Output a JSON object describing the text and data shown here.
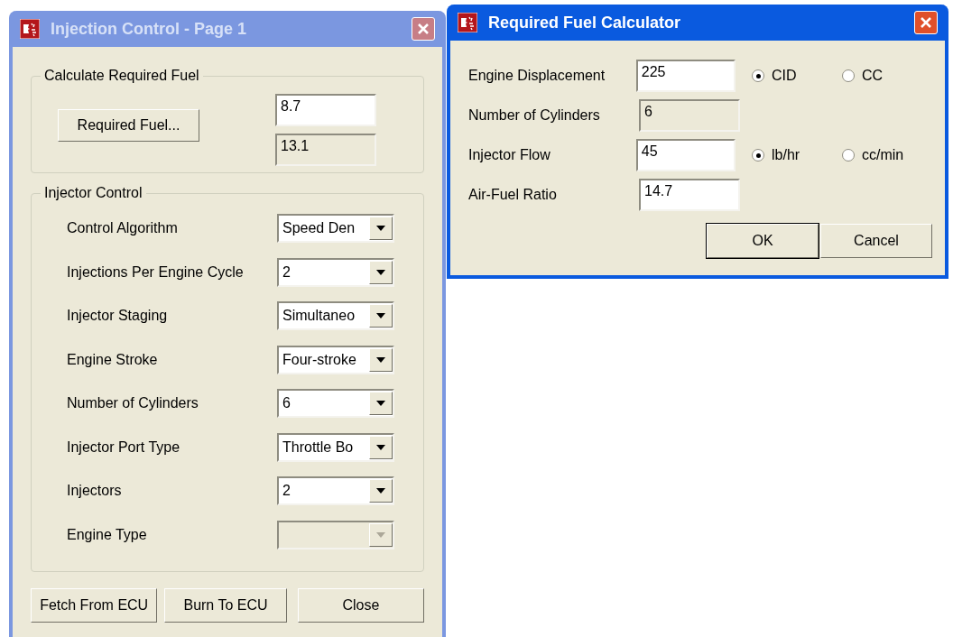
{
  "injection_window": {
    "title": "Injection Control - Page 1",
    "active": false,
    "fuel_group": {
      "legend": "Calculate Required Fuel",
      "button": "Required Fuel...",
      "fields": [
        {
          "value": "8.7",
          "readonly": false
        },
        {
          "value": "13.1",
          "readonly": true
        }
      ]
    },
    "injector_group": {
      "legend": "Injector Control",
      "rows": [
        {
          "label": "Control Algorithm",
          "value": "Speed Den",
          "disabled": false
        },
        {
          "label": "Injections Per Engine Cycle",
          "value": "2",
          "disabled": false
        },
        {
          "label": "Injector Staging",
          "value": "Simultaneo",
          "disabled": false
        },
        {
          "label": "Engine Stroke",
          "value": "Four-stroke",
          "disabled": false
        },
        {
          "label": "Number of Cylinders",
          "value": "6",
          "disabled": false
        },
        {
          "label": "Injector Port Type",
          "value": "Throttle Bo",
          "disabled": false
        },
        {
          "label": "Injectors",
          "value": "2",
          "disabled": false
        },
        {
          "label": "Engine Type",
          "disabled": true
        }
      ]
    },
    "buttons": [
      "Fetch From ECU",
      "Burn To ECU",
      "Close"
    ]
  },
  "calculator_window": {
    "title": "Required Fuel Calculator",
    "active": true,
    "rows": [
      {
        "label": "Engine Displacement",
        "value": "225",
        "readonly": false,
        "options": [
          {
            "label": "CID",
            "selected": true
          },
          {
            "label": "CC",
            "selected": false
          }
        ]
      },
      {
        "label": "Number of Cylinders",
        "value": "6",
        "readonly": true
      },
      {
        "label": "Injector Flow",
        "value": "45",
        "readonly": false,
        "options": [
          {
            "label": "lb/hr",
            "selected": true
          },
          {
            "label": "cc/min",
            "selected": false
          }
        ]
      },
      {
        "label": "Air-Fuel Ratio",
        "value": "14.7",
        "readonly": false
      }
    ],
    "buttons": [
      {
        "label": "OK",
        "default": true
      },
      {
        "label": "Cancel",
        "default": false
      }
    ]
  }
}
